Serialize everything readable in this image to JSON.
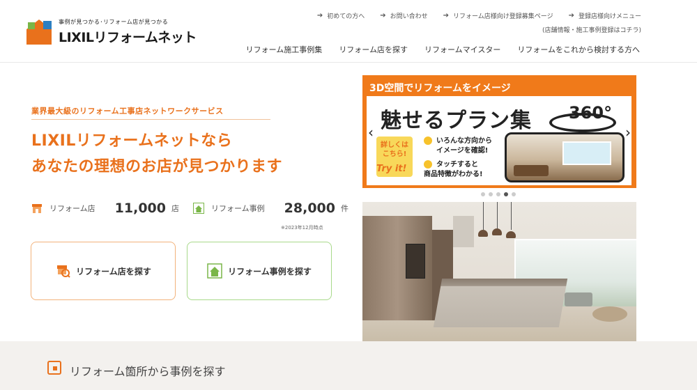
{
  "header": {
    "tagline": "事例が見つかる･リフォーム店が見つかる",
    "logo_name": "LIXILリフォームネット",
    "util_links": [
      {
        "label": "初めての方へ"
      },
      {
        "label": "お問い合わせ"
      },
      {
        "label": "リフォーム店様向け登録募集ページ"
      },
      {
        "label": "登録店様向けメニュー"
      }
    ],
    "util_extra": "(店舗情報・施工事例登録はコチラ)",
    "nav": [
      {
        "label": "リフォーム施工事例集"
      },
      {
        "label": "リフォーム店を探す"
      },
      {
        "label": "リフォームマイスター"
      },
      {
        "label": "リフォームをこれから検討する方へ"
      }
    ]
  },
  "hero": {
    "subtitle": "業界最大級のリフォーム工事店ネットワークサービス",
    "title_line1": "LIXILリフォームネットなら",
    "title_line2": "あなたの理想のお店が見つかります",
    "stats": {
      "shops_label": "リフォーム店",
      "shops_count": "11,000",
      "shops_unit": "店",
      "cases_label": "リフォーム事例",
      "cases_count": "28,000",
      "cases_unit": "件",
      "note": "※2023年12月時点"
    },
    "cta_shop": "リフォーム店を探す",
    "cta_case": "リフォーム事例を探す"
  },
  "banner": {
    "top_text": "3D空間でリフォームをイメージ",
    "title": "魅せるプラン集",
    "badge_360": "360°",
    "detail_badge": "詳しくは こちら!",
    "try_text": "Try it!",
    "feature1_line1": "いろんな方向から",
    "feature1_line2": "イメージを確認!",
    "feature2_line1": "タッチすると",
    "feature2_line2": "商品特徴がわかる!",
    "slides": 5,
    "active_slide": 4
  },
  "bottom": {
    "title": "リフォーム箇所から事例を探す"
  },
  "colors": {
    "accent": "#e9711c",
    "green": "#7ab648",
    "blue": "#2d7fc1"
  }
}
